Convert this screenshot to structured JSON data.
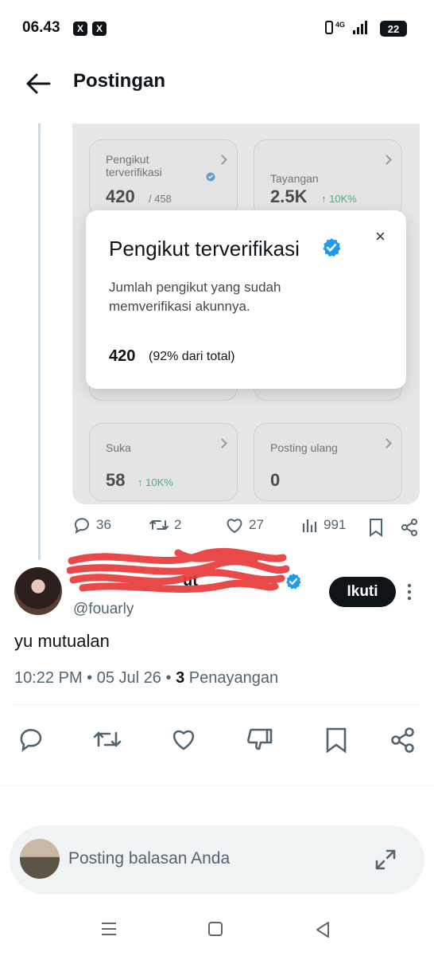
{
  "status": {
    "time": "06.43",
    "app_badges": [
      "X",
      "X"
    ],
    "network": "4G",
    "battery": "22"
  },
  "header": {
    "title": "Postingan"
  },
  "embed": {
    "cards": [
      {
        "label": "Pengikut\nterverifikasi",
        "value": "420",
        "sub": "/ 458",
        "delta": "",
        "verified": true
      },
      {
        "label": "Tayangan",
        "value": "2.5K",
        "sub": "",
        "delta": "↑ 10K%",
        "verified": false
      },
      {
        "label": "Suka",
        "value": "58",
        "sub": "",
        "delta": "↑ 10K%",
        "verified": false
      },
      {
        "label": "Posting ulang",
        "value": "0",
        "sub": "",
        "delta": "",
        "verified": false
      }
    ],
    "popup": {
      "title": "Pengikut terverifikasi",
      "description": "Jumlah pengikut yang sudah memverifikasi akunnya.",
      "count": "420",
      "percent": "(92% dari total)",
      "close": "×"
    }
  },
  "quoted_actions": {
    "replies": "36",
    "reposts": "2",
    "likes": "27",
    "views": "991"
  },
  "post": {
    "display_name": "ut",
    "handle": "@fouarly",
    "follow_label": "Ikuti",
    "text": "yu mutualan",
    "time": "10:22 PM",
    "date": "05 Jul 26",
    "views_count": "3",
    "views_label": "Penayangan",
    "separator": "•"
  },
  "reply": {
    "placeholder": "Posting balasan Anda"
  },
  "colors": {
    "verified": "#1d9bf0",
    "delta_green": "#48b07a",
    "follow_bg": "#0f1419",
    "redaction": "#e8393b"
  }
}
